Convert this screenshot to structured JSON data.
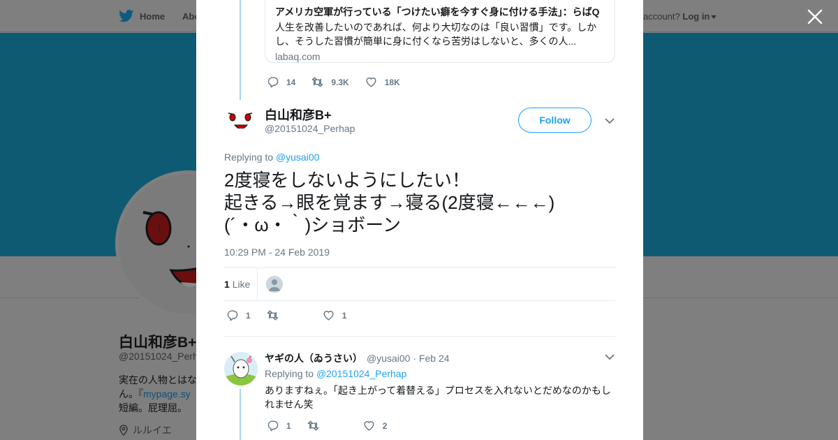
{
  "nav": {
    "home": "Home",
    "about": "Abo",
    "account_prompt": "account?",
    "login": "Log in"
  },
  "background_profile": {
    "name": "白山和彦B+",
    "handle": "@20151024_Perhap",
    "bio_line1": "実在の人物とはな",
    "bio_line2a": "ん。『",
    "bio_link": "mypage.sy",
    "bio_line3": "短編。屁理屈。",
    "location": "ルルイエ"
  },
  "prev_tweet": {
    "card_title": "アメリカ空軍が行っている「つけたい癖を今すぐ身に付ける手法」：らばQ",
    "card_desc": "人生を改善したいのであれば、何より大切なのは「良い習慣」です。しかし、そうした習慣が簡単に身に付くなら苦労はしないと、多くの人...",
    "card_domain": "labaq.com",
    "replies": "14",
    "retweets": "9.3K",
    "likes": "18K"
  },
  "main_tweet": {
    "name": "白山和彦B+",
    "handle": "@20151024_Perhap",
    "follow_label": "Follow",
    "replying_prefix": "Replying to",
    "replying_to": "@yusai00",
    "text_lines": [
      "2度寝をしないようにしたい！",
      "起きる→眼を覚ます→寝る(2度寝←←←)",
      "(´・ω・｀)ショボーン"
    ],
    "timestamp": "10:29 PM - 24 Feb 2019",
    "like_count": "1",
    "like_label": "Like",
    "replies": "1",
    "retweets": "",
    "likes": "1"
  },
  "reply_tweet": {
    "name": "ヤギの人（ゐうさい）",
    "handle": "@yusai00",
    "date": "· Feb 24",
    "replying_prefix": "Replying to",
    "replying_to": "@20151024_Perhap",
    "text": "ありますねぇ。「起き上がって着替える」プロセスを入れないとだめなのかもしれません笑",
    "replies": "1",
    "retweets": "",
    "likes": "2"
  },
  "colors": {
    "accent": "#1da1f2",
    "thread_line": "#a6d2f3",
    "muted": "#657786",
    "overlay": "#7f7f7f"
  },
  "icons": [
    "twitter-bird-icon",
    "close-icon",
    "reply-icon",
    "retweet-icon",
    "heart-icon",
    "chevron-down-icon",
    "location-icon"
  ]
}
